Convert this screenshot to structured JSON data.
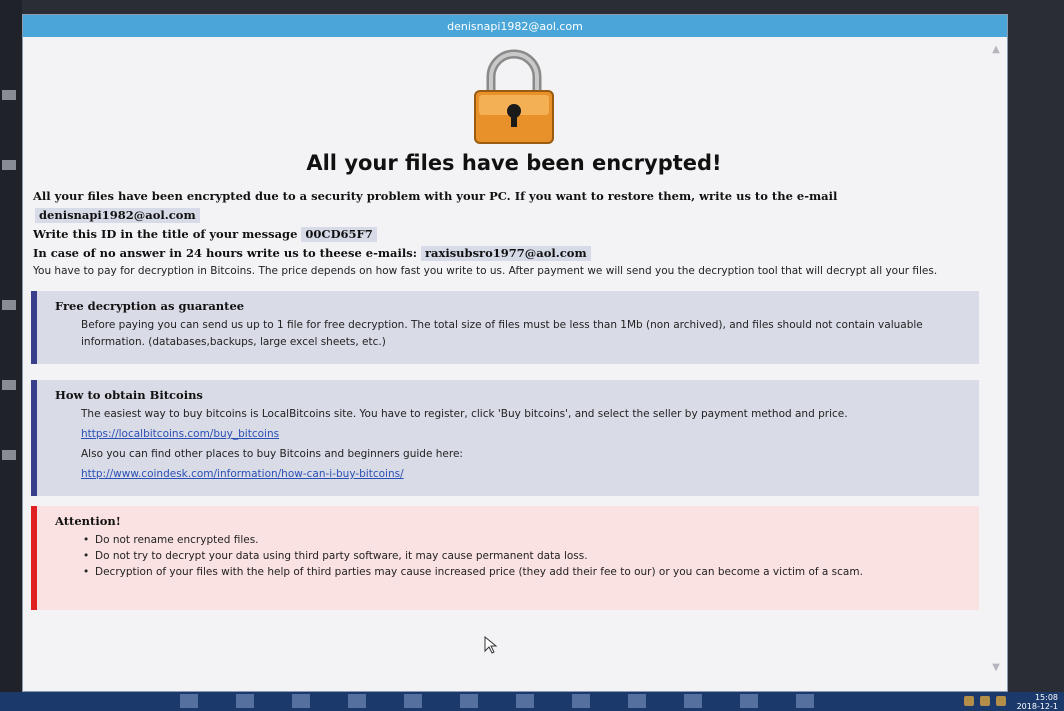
{
  "window": {
    "title": "denisnapi1982@aol.com"
  },
  "header": {
    "icon": "padlock-icon",
    "heading": "All your files have been encrypted!"
  },
  "intro": {
    "line1": "All your files have been encrypted due to a security problem with your PC. If you want to restore them, write us to the e-mail",
    "email": "denisnapi1982@aol.com",
    "id_label": "Write this ID in the title of your message",
    "id_value": "00CD65F7",
    "backup_label": "In case of no answer in 24 hours write us to theese e-mails:",
    "backup_email": "raxisubsro1977@aol.com",
    "payment_note": "You have to pay for decryption in Bitcoins. The price depends on how fast you write to us. After payment we will send you the decryption tool that will decrypt all your files."
  },
  "free_panel": {
    "title": "Free decryption as guarantee",
    "text1": "Before paying you can send us up to 1 file for free decryption. The total size of files must be less than 1Mb (non archived), and files should not contain valuable",
    "text2": "information. (databases,backups, large excel sheets, etc.)"
  },
  "bitcoin_panel": {
    "title": "How to obtain Bitcoins",
    "text1": "The easiest way to buy bitcoins is LocalBitcoins site. You have to register, click 'Buy bitcoins', and select the seller by payment method and price.",
    "link1": "https://localbitcoins.com/buy_bitcoins",
    "text2": "Also you can find other places to buy Bitcoins and beginners guide here:",
    "link2": "http://www.coindesk.com/information/how-can-i-buy-bitcoins/"
  },
  "attention_panel": {
    "title": "Attention!",
    "items": [
      "Do not rename encrypted files.",
      "Do not try to decrypt your data using third party software, it may cause permanent data loss.",
      "Decryption of your files with the help of third parties may cause increased price (they add their fee to our) or you can become a victim of a scam."
    ]
  },
  "taskbar": {
    "time": "15:08",
    "date": "2018-12-1"
  },
  "colors": {
    "titlebar": "#4aa6d8",
    "blue_accent": "#3a3f8c",
    "red_accent": "#e02020",
    "lock_body": "#f0a23a"
  }
}
